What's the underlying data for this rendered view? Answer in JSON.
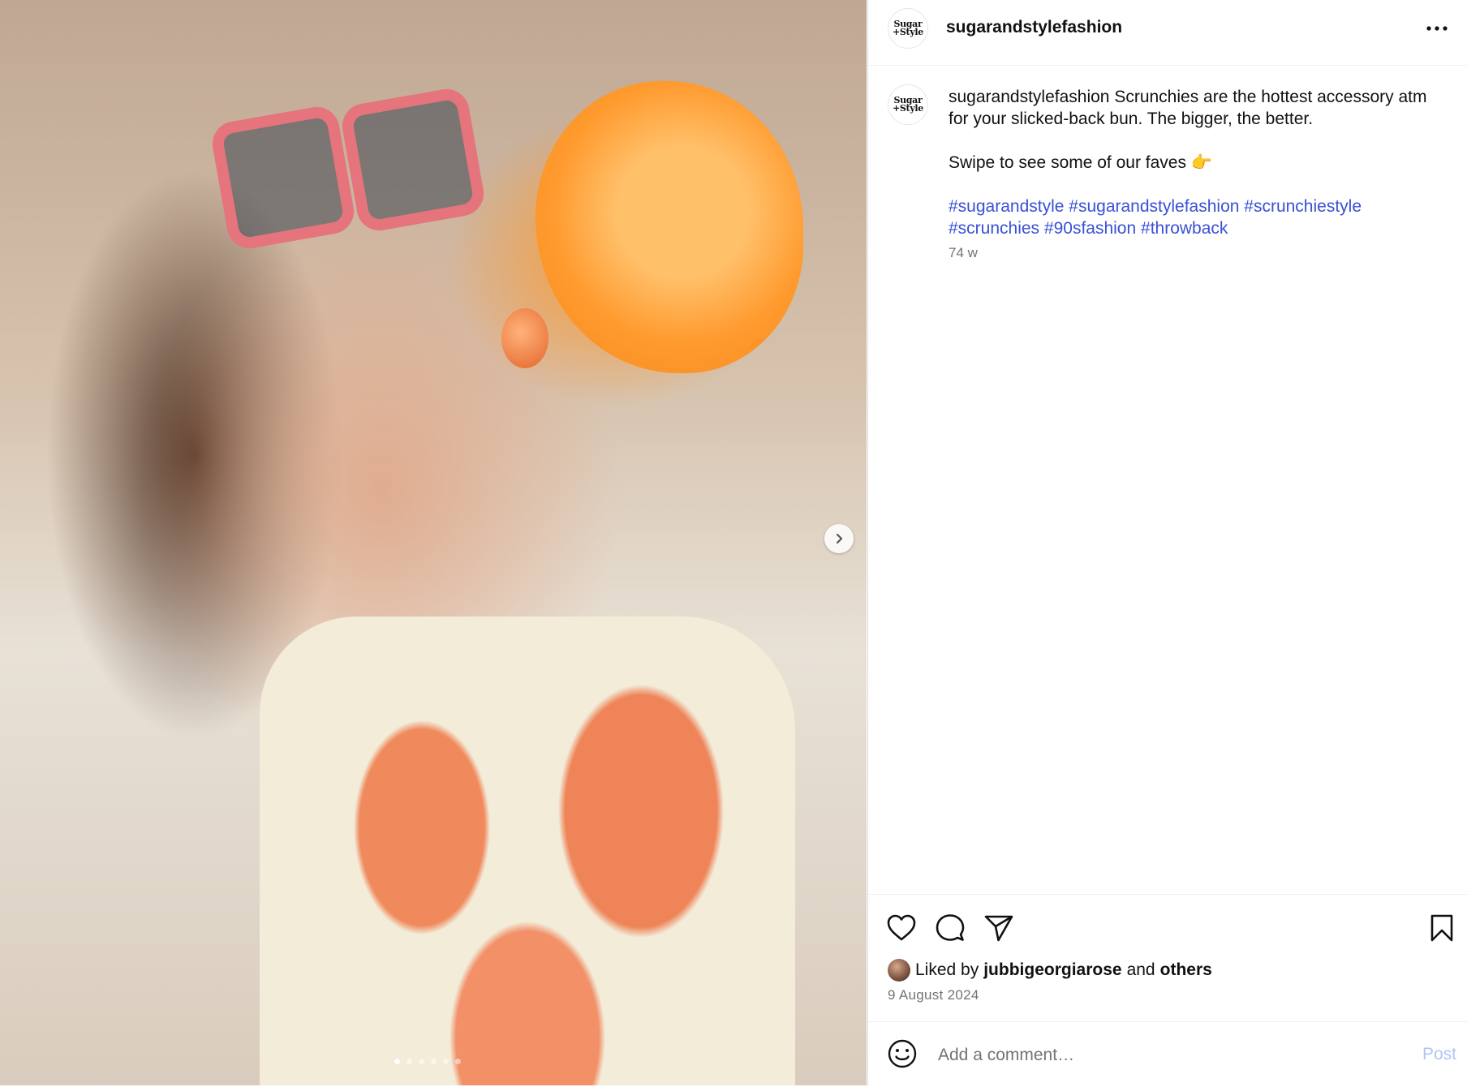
{
  "post": {
    "username": "sugarandstylefashion",
    "avatar_logo_line1": "Sugar",
    "avatar_logo_line2": "+Style",
    "caption_user": "sugarandstylefashion",
    "caption_text": "Scrunchies are the hottest accessory atm for your slicked-back bun. The bigger, the better.",
    "caption_swipe": "Swipe to see some of our faves 👉",
    "hashtags": [
      "#sugarandstyle",
      "#sugarandstylefashion",
      "#scrunchiestyle",
      "#scrunchies",
      "#90sfashion",
      "#throwback"
    ],
    "time_ago": "74 w",
    "liked_by_prefix": "Liked by",
    "liked_by_user": "jubbigeorgiarose",
    "liked_by_and": "and",
    "liked_by_others": "others",
    "date": "9 August 2024"
  },
  "comment": {
    "placeholder": "Add a comment…",
    "post_label": "Post"
  },
  "carousel": {
    "total_slides": 6,
    "current_slide": 1
  },
  "icons": {
    "more": "more-horizontal-icon",
    "like": "heart-icon",
    "comment": "comment-bubble-icon",
    "share": "paper-plane-icon",
    "save": "bookmark-icon",
    "emoji": "smiley-icon",
    "next": "chevron-right-icon"
  },
  "colors": {
    "hashtag": "#3a50d6",
    "secondary_text": "#737373",
    "post_button": "#b2c4f6"
  }
}
